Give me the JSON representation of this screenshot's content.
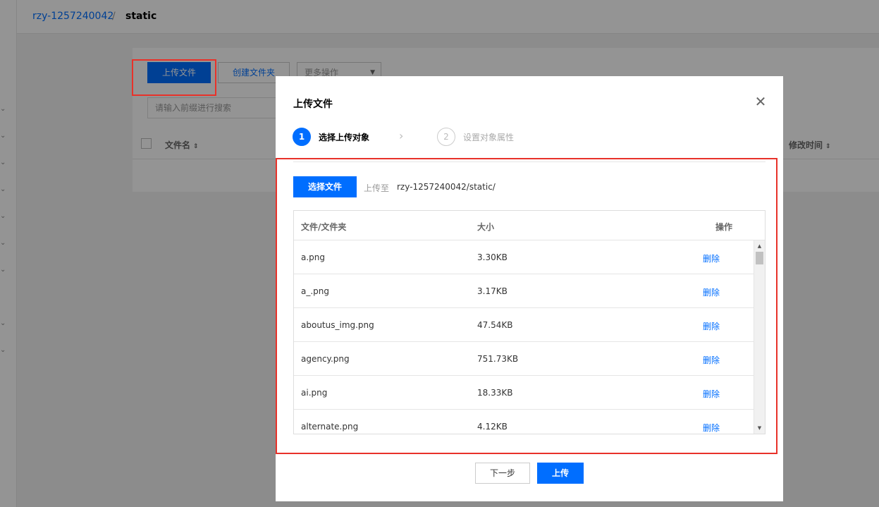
{
  "breadcrumb": {
    "bucket": "rzy-1257240042",
    "separator": "/",
    "current": "static"
  },
  "background": {
    "upload_label": "上传文件",
    "mkdir_label": "创建文件夹",
    "more_label": "更多操作",
    "search_placeholder": "请输入前缀进行搜索",
    "col_name": "文件名",
    "col_mtime": "修改时间"
  },
  "modal": {
    "title": "上传文件",
    "close_icon": "close-icon",
    "steps": [
      {
        "number": "1",
        "label": "选择上传对象"
      },
      {
        "number": "2",
        "label": "设置对象属性"
      }
    ],
    "select_file_label": "选择文件",
    "upload_to_label": "上传至",
    "upload_to_path": "rzy-1257240042/static/",
    "table": {
      "headers": {
        "name": "文件/文件夹",
        "size": "大小",
        "op": "操作"
      },
      "rows": [
        {
          "name": "a.png",
          "size": "3.30KB",
          "action": "删除"
        },
        {
          "name": "a_.png",
          "size": "3.17KB",
          "action": "删除"
        },
        {
          "name": "aboutus_img.png",
          "size": "47.54KB",
          "action": "删除"
        },
        {
          "name": "agency.png",
          "size": "751.73KB",
          "action": "删除"
        },
        {
          "name": "ai.png",
          "size": "18.33KB",
          "action": "删除"
        },
        {
          "name": "alternate.png",
          "size": "4.12KB",
          "action": "删除"
        }
      ]
    },
    "next_label": "下一步",
    "upload_label": "上传"
  },
  "colors": {
    "primary": "#006eff",
    "highlight": "#e8322a"
  }
}
